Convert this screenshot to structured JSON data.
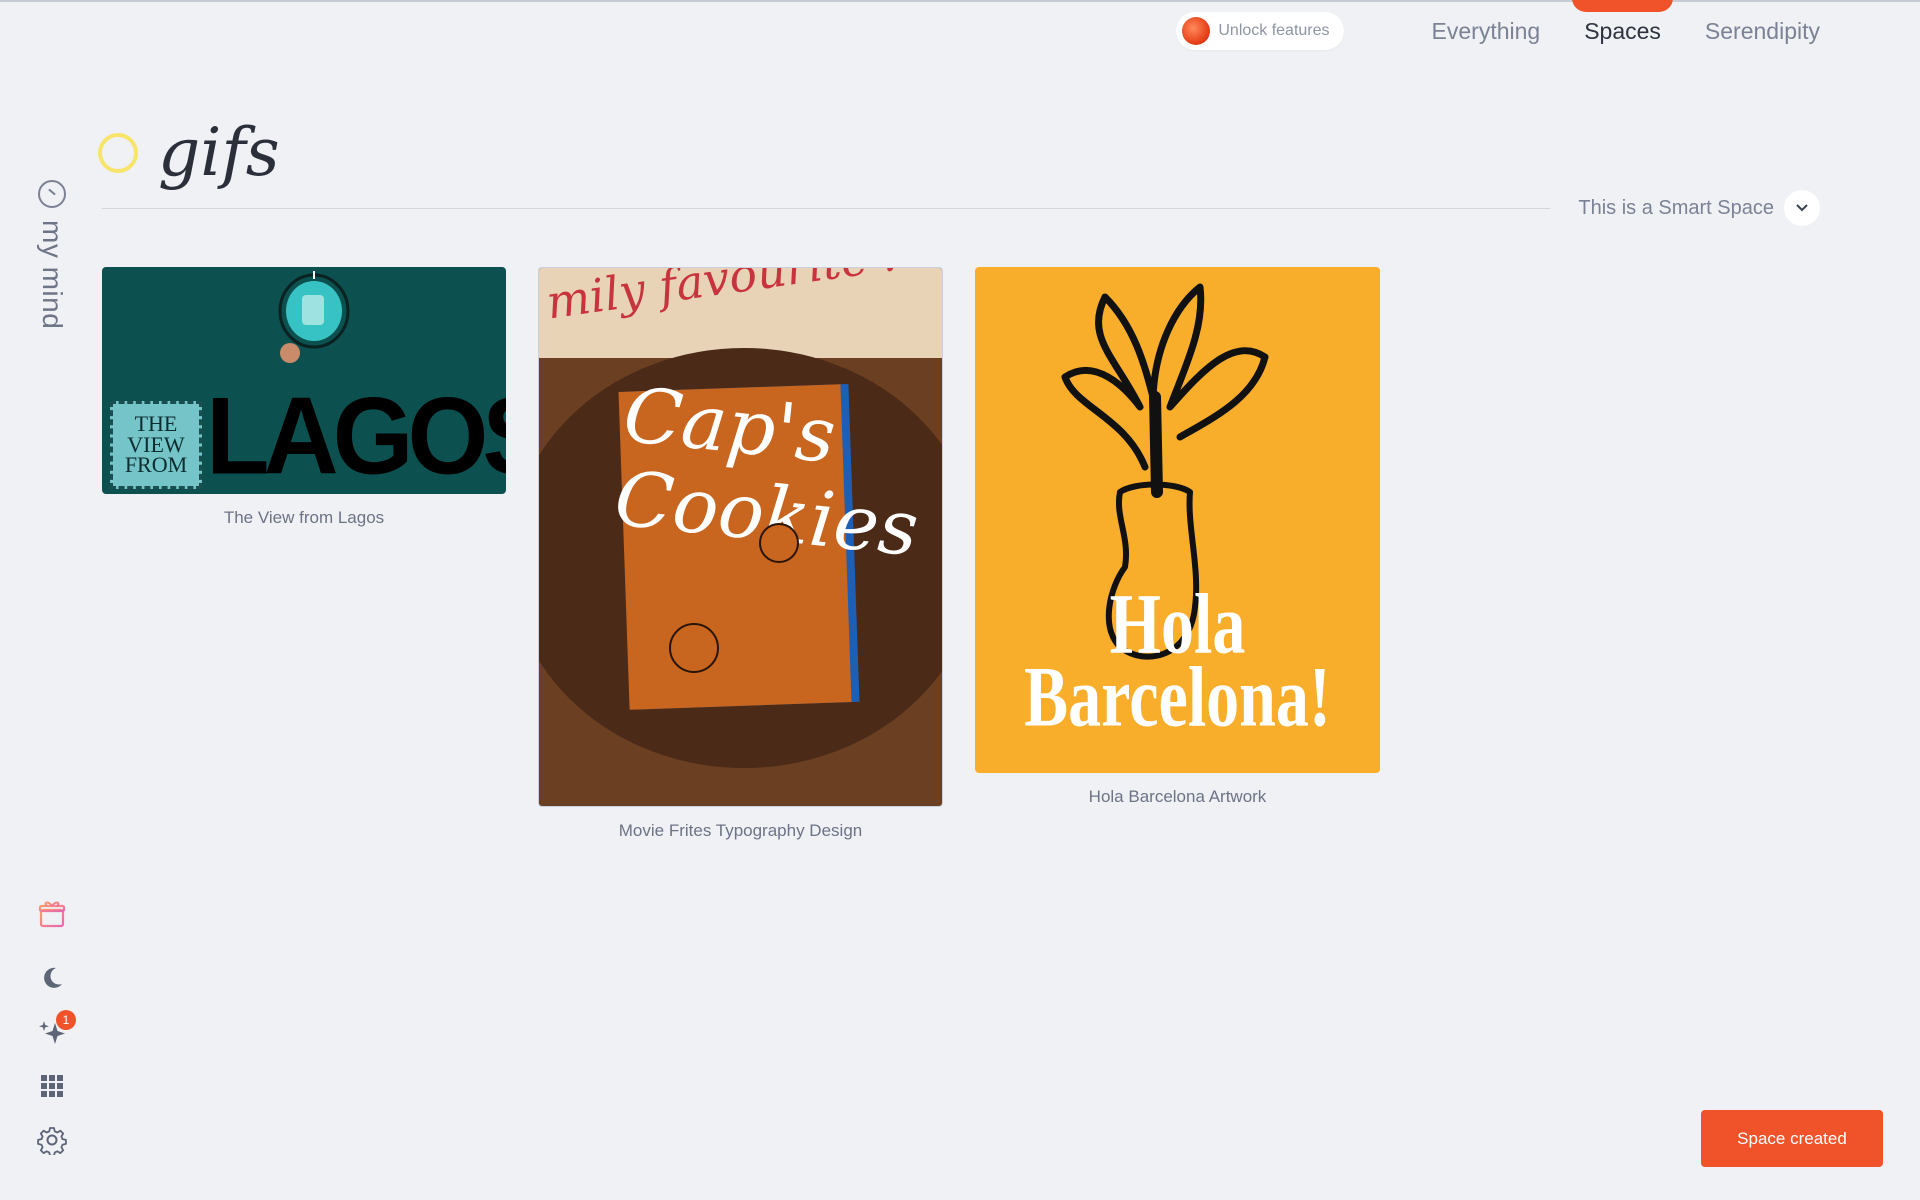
{
  "nav": {
    "unlock_label": "Unlock features",
    "tabs": [
      "Everything",
      "Spaces",
      "Serendipity"
    ],
    "active_tab": "Spaces"
  },
  "sidebar": {
    "brand": "my mind",
    "icons": [
      "gift-icon",
      "moon-icon",
      "sparkle-icon",
      "grid-icon",
      "gear-icon"
    ],
    "sparkle_badge": "1"
  },
  "space": {
    "title": "gifs",
    "smart_label": "This is a Smart Space"
  },
  "cards": [
    {
      "caption": "The View from Lagos",
      "stamp_lines": [
        "THE",
        "VIEW",
        "FROM"
      ],
      "headline": "LAGOS"
    },
    {
      "caption": "Movie Frites Typography Design",
      "tagline": "mily favourite !",
      "box_lines": [
        "Cap's",
        "Cookies"
      ]
    },
    {
      "caption": "Hola Barcelona Artwork",
      "headline_lines": [
        "Hola",
        "Barcelona!"
      ]
    }
  ],
  "toast": "Space created",
  "colors": {
    "accent": "#f0522a",
    "background": "#eff1f5",
    "space_dot": "#f7e46b"
  }
}
